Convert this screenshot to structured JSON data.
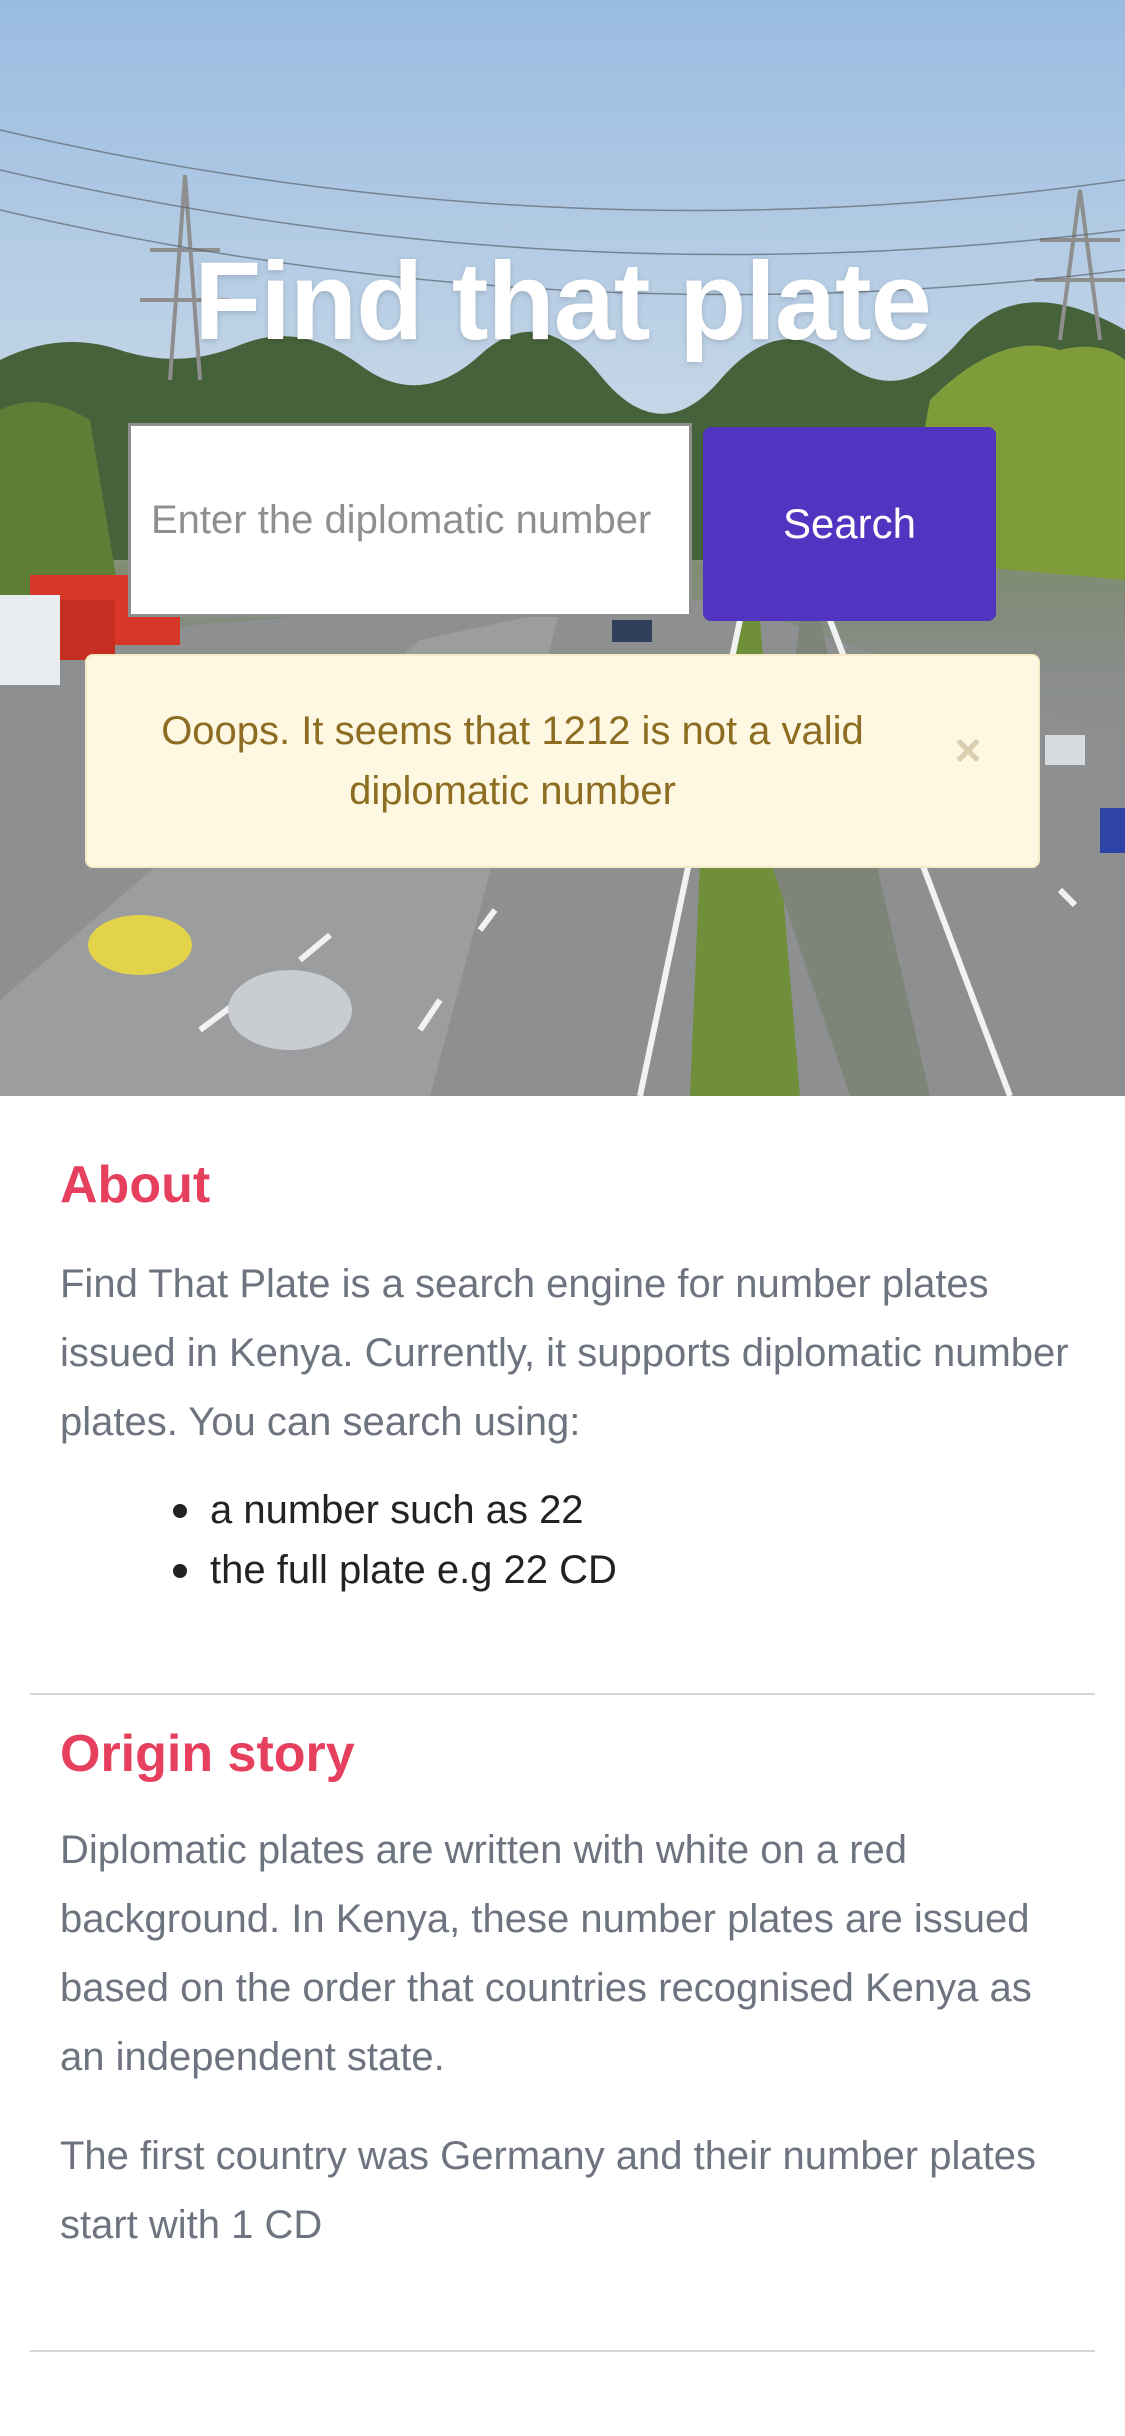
{
  "hero": {
    "title": "Find that plate",
    "search_placeholder": "Enter the diplomatic number",
    "search_value": "",
    "search_button_label": "Search"
  },
  "alert": {
    "message": "Ooops. It seems that 1212 is not a valid diplomatic number",
    "close_symbol": "×"
  },
  "about": {
    "title": "About",
    "text": "Find That Plate is a search engine for number plates issued in Kenya. Currently, it supports diplomatic number plates. You can search using:",
    "list": [
      "a number such as 22",
      "the full plate e.g 22 CD"
    ]
  },
  "origin": {
    "title": "Origin story",
    "text_1": "Diplomatic plates are written with white on a red background. In Kenya, these number plates are issued based on the order that countries recognised Kenya as an independent state.",
    "text_2": "The first country was Germany and their number plates start with 1 CD"
  },
  "colors": {
    "primary": "#5134c0",
    "accent": "#e6405e",
    "alert_bg": "#fef8e3",
    "alert_text": "#8c6d22"
  }
}
